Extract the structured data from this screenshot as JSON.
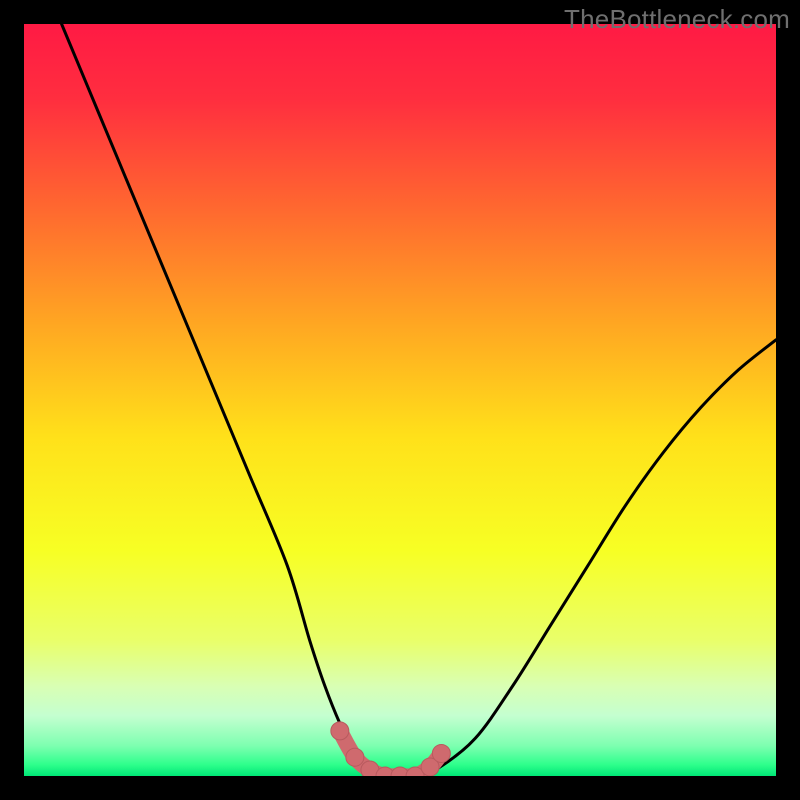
{
  "watermark": "TheBottleneck.com",
  "colors": {
    "frame": "#000000",
    "gradient_stops": [
      {
        "offset": 0.0,
        "color": "#ff1a44"
      },
      {
        "offset": 0.1,
        "color": "#ff2e3f"
      },
      {
        "offset": 0.25,
        "color": "#ff6a2f"
      },
      {
        "offset": 0.4,
        "color": "#ffa722"
      },
      {
        "offset": 0.55,
        "color": "#ffe11a"
      },
      {
        "offset": 0.7,
        "color": "#f7ff24"
      },
      {
        "offset": 0.82,
        "color": "#e9ff6a"
      },
      {
        "offset": 0.88,
        "color": "#d9ffb3"
      },
      {
        "offset": 0.92,
        "color": "#c4ffd0"
      },
      {
        "offset": 0.96,
        "color": "#7dffb0"
      },
      {
        "offset": 0.985,
        "color": "#2eff8c"
      },
      {
        "offset": 1.0,
        "color": "#00e676"
      }
    ],
    "curve": "#000000",
    "marker_fill": "#cf6a6e",
    "marker_stroke": "#b85a5e"
  },
  "chart_data": {
    "type": "line",
    "title": "",
    "xlabel": "",
    "ylabel": "",
    "xlim": [
      0,
      100
    ],
    "ylim": [
      0,
      100
    ],
    "series": [
      {
        "name": "bottleneck-curve",
        "x": [
          5,
          10,
          15,
          20,
          25,
          30,
          35,
          38,
          40,
          42,
          44,
          46,
          48,
          50,
          52,
          55,
          60,
          65,
          70,
          75,
          80,
          85,
          90,
          95,
          100
        ],
        "y": [
          100,
          88,
          76,
          64,
          52,
          40,
          28,
          18,
          12,
          7,
          3,
          1,
          0,
          0,
          0,
          1,
          5,
          12,
          20,
          28,
          36,
          43,
          49,
          54,
          58
        ]
      }
    ],
    "markers": {
      "name": "highlight-segment",
      "x": [
        42,
        44,
        46,
        48,
        50,
        52,
        54,
        55.5
      ],
      "y": [
        6,
        2.5,
        0.8,
        0,
        0,
        0,
        1.2,
        3
      ]
    }
  }
}
